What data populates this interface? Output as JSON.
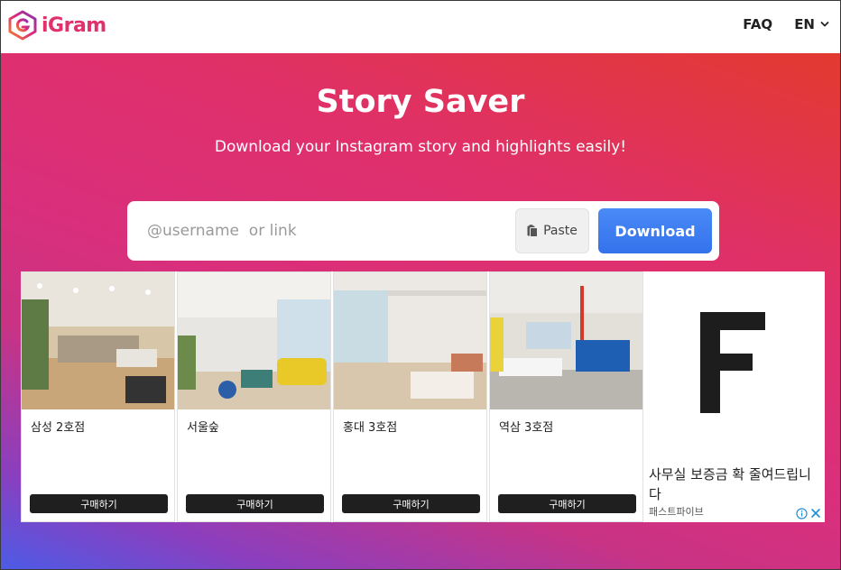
{
  "header": {
    "brand": "iGram",
    "brand_color": "#e1306c",
    "faq_label": "FAQ",
    "lang_label": "EN",
    "lang_icon": "chevron-down-icon"
  },
  "hero": {
    "title": "Story Saver",
    "subtitle": "Download your Instagram story and highlights easily!",
    "gradient_colors": [
      "#e23a2f",
      "#e0306a",
      "#c93384",
      "#4d5be6"
    ]
  },
  "search": {
    "placeholder": "@username  or link",
    "value": "",
    "paste_label": "Paste",
    "paste_icon": "clipboard-icon",
    "download_label": "Download",
    "download_color": "#3c7ef4"
  },
  "ad": {
    "cards": [
      {
        "label": "삼성 2호점",
        "button": "구매하기"
      },
      {
        "label": "서울숲",
        "button": "구매하기"
      },
      {
        "label": "홍대 3호점",
        "button": "구매하기"
      },
      {
        "label": "역삼 3호점",
        "button": "구매하기"
      }
    ],
    "side": {
      "logo_icon": "fastfive-f-logo",
      "text": "사무실 보증금 확 줄여드립니다",
      "brand": "패스트파이브",
      "info_icon": "info-icon",
      "close_icon": "close-icon"
    }
  }
}
